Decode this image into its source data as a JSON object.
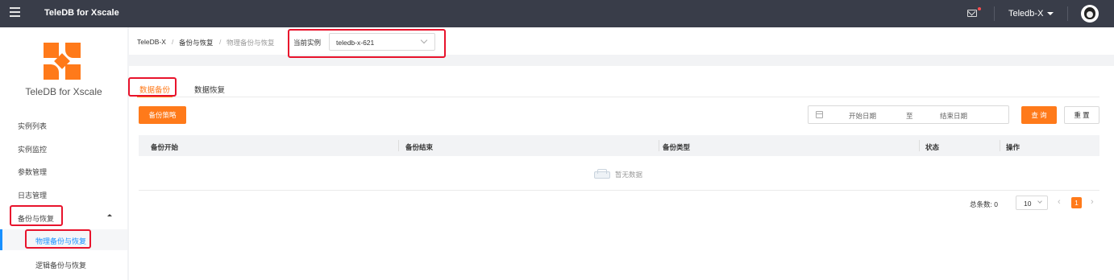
{
  "topbar": {
    "app_title": "TeleDB for Xscale",
    "user_name": "Teledb-X"
  },
  "sidebar": {
    "brand": "TeleDB for Xscale",
    "items": [
      {
        "label": "实例列表"
      },
      {
        "label": "实例监控"
      },
      {
        "label": "参数管理"
      },
      {
        "label": "日志管理"
      },
      {
        "label": "备份与恢复",
        "expanded": true
      }
    ],
    "subitems": [
      {
        "label": "物理备份与恢复",
        "active": true
      },
      {
        "label": "逻辑备份与恢复"
      }
    ]
  },
  "breadcrumb": {
    "items": [
      "TeleDB-X",
      "备份与恢复",
      "物理备份与恢复"
    ],
    "separator": "/"
  },
  "instance_select": {
    "label": "当前实例",
    "value": "teledb-x-621"
  },
  "tabs": [
    {
      "label": "数据备份",
      "active": true
    },
    {
      "label": "数据恢复"
    }
  ],
  "toolbar": {
    "backup_policy_label": "备份策略",
    "start_date_placeholder": "开始日期",
    "range_sep": "至",
    "end_date_placeholder": "结束日期",
    "query_label": "查 询",
    "reset_label": "重 置"
  },
  "table": {
    "columns": [
      "备份开始",
      "备份结束",
      "备份类型",
      "状态",
      "操作"
    ],
    "rows": [],
    "empty_text": "暂无数据"
  },
  "pagination": {
    "total_label": "总条数: 0",
    "page_size": "10",
    "current_page": "1",
    "prev": "‹",
    "next": "›"
  },
  "colors": {
    "accent": "#ff7a1a",
    "active_link": "#1890ff",
    "topbar": "#393d49",
    "highlight": "#e8132c"
  }
}
